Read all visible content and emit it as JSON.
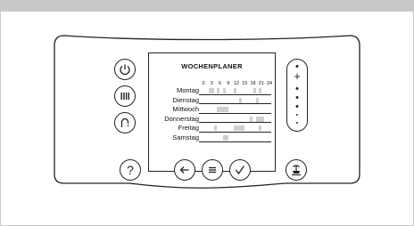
{
  "panel": {
    "title": "WOCHENPLANER",
    "hours": [
      "0",
      "3",
      "6",
      "9",
      "12",
      "15",
      "18",
      "21",
      "24"
    ],
    "days": [
      {
        "label": "Montag",
        "blocks": [
          [
            2,
            4
          ],
          [
            5,
            6
          ],
          [
            7,
            8
          ],
          [
            11,
            12
          ],
          [
            18,
            19
          ],
          [
            20,
            21
          ]
        ]
      },
      {
        "label": "Dienstag",
        "blocks": [
          [
            13,
            14
          ],
          [
            19,
            20
          ]
        ]
      },
      {
        "label": "Mittwoch",
        "blocks": [
          [
            5,
            9
          ]
        ]
      },
      {
        "label": "Donnerstag",
        "blocks": [
          [
            17,
            18
          ],
          [
            19,
            22
          ]
        ]
      },
      {
        "label": "Freitag",
        "blocks": [
          [
            4,
            5
          ],
          [
            11,
            15
          ],
          [
            20,
            21
          ]
        ]
      },
      {
        "label": "Samstag",
        "blocks": [
          [
            7,
            9
          ]
        ]
      }
    ],
    "help_label": "?",
    "slider_plus": "+",
    "colors": {
      "outline": "#222222",
      "block": "#cfcfcf",
      "topbar": "#c9c9c9"
    }
  },
  "icons": {
    "left_column": [
      "power-icon",
      "heating-icon",
      "hot-water-icon"
    ],
    "bottom_row": [
      "help-icon",
      "back-arrow-icon",
      "menu-icon",
      "confirm-check-icon"
    ],
    "right": [
      "vacation-icon"
    ]
  }
}
